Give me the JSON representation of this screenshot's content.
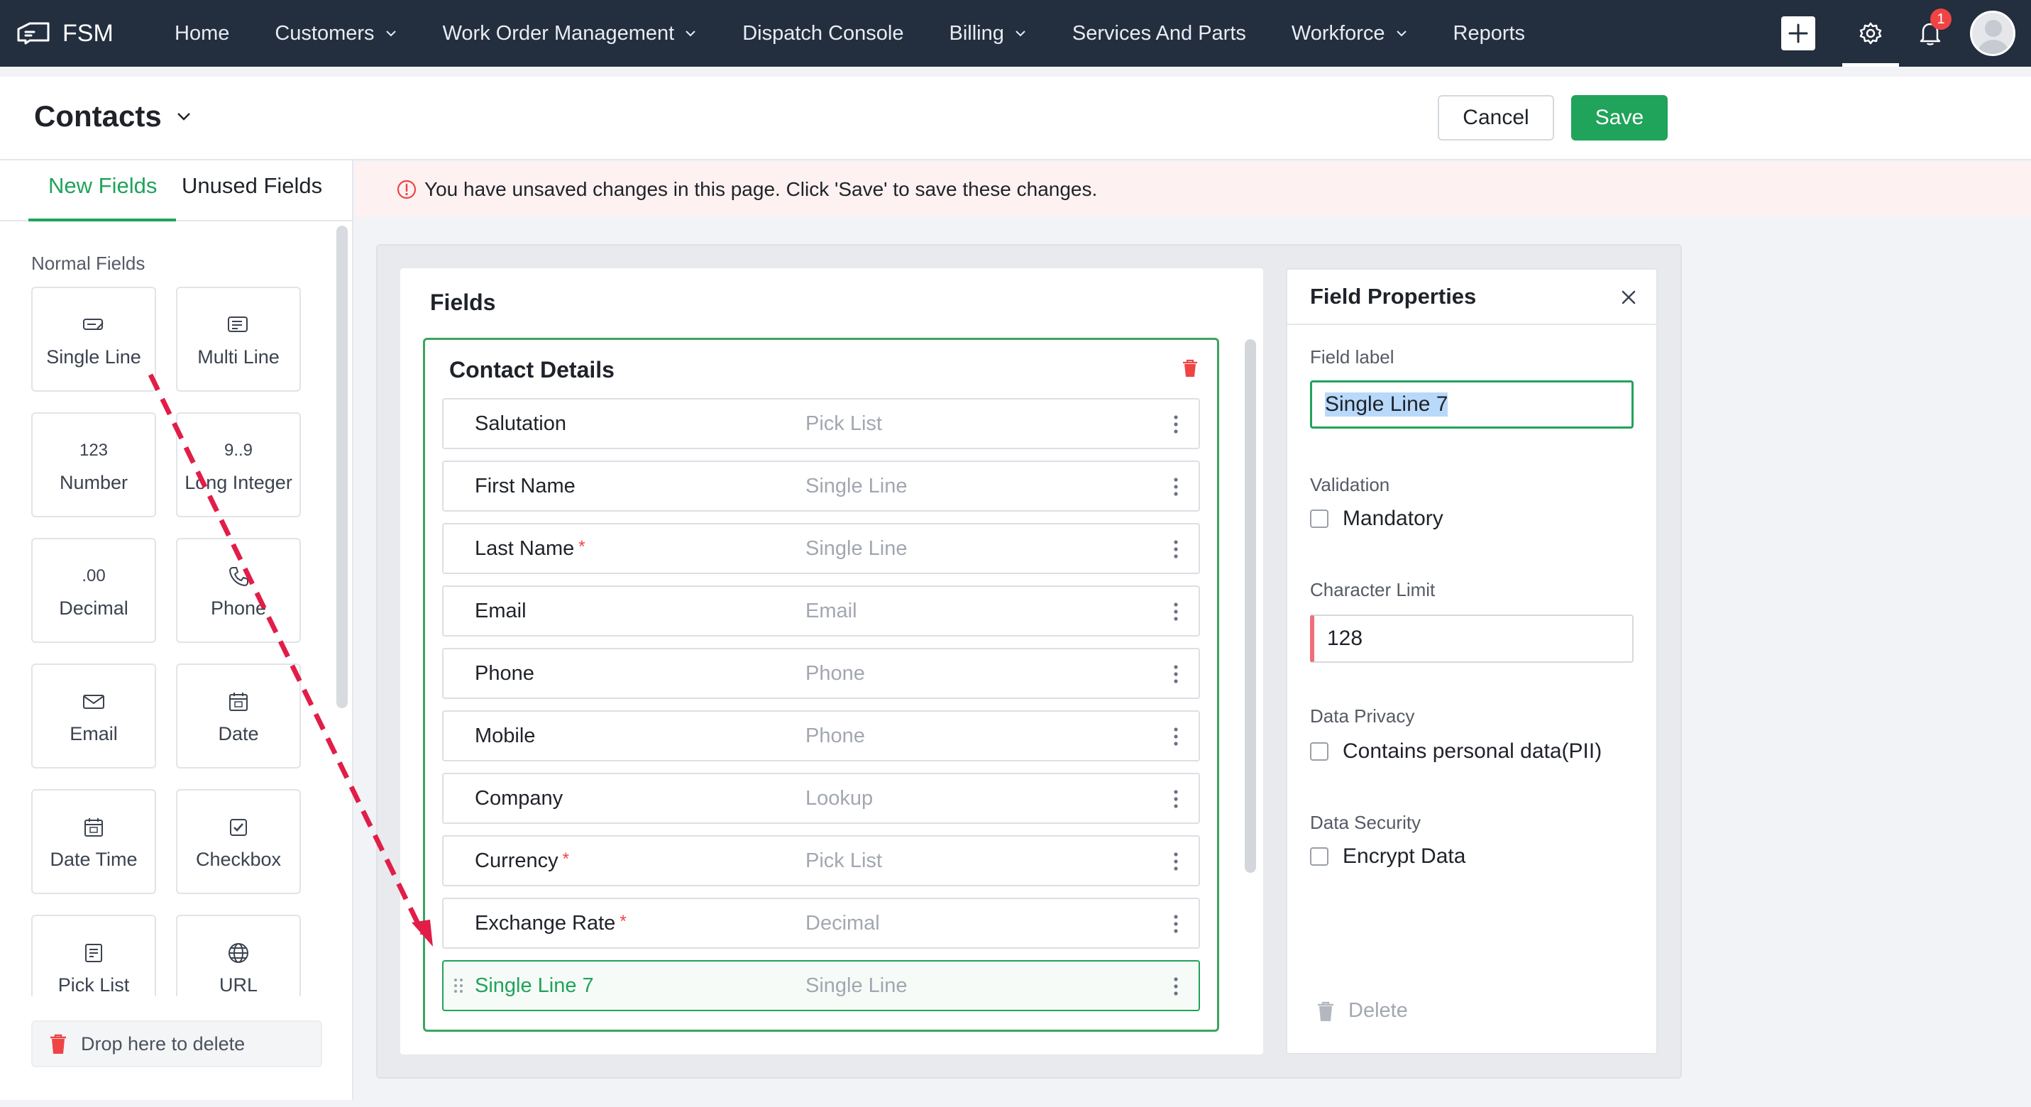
{
  "nav": {
    "brand": "FSM",
    "items": [
      {
        "label": "Home",
        "dropdown": false
      },
      {
        "label": "Customers",
        "dropdown": true
      },
      {
        "label": "Work Order Management",
        "dropdown": true
      },
      {
        "label": "Dispatch Console",
        "dropdown": false
      },
      {
        "label": "Billing",
        "dropdown": true
      },
      {
        "label": "Services And Parts",
        "dropdown": false
      },
      {
        "label": "Workforce",
        "dropdown": true
      },
      {
        "label": "Reports",
        "dropdown": false
      }
    ],
    "notification_count": "1"
  },
  "header": {
    "title": "Contacts",
    "cancel_label": "Cancel",
    "save_label": "Save"
  },
  "left_panel": {
    "tabs": [
      "New Fields",
      "Unused Fields"
    ],
    "active_tab": "New Fields",
    "section_label": "Normal Fields",
    "palette": [
      {
        "label": "Single Line",
        "icon": "single-line-icon",
        "glyph": ""
      },
      {
        "label": "Multi Line",
        "icon": "multi-line-icon",
        "glyph": ""
      },
      {
        "label": "Number",
        "icon": "number-icon",
        "glyph": "123"
      },
      {
        "label": "Long Integer",
        "icon": "long-integer-icon",
        "glyph": "9..9"
      },
      {
        "label": "Decimal",
        "icon": "decimal-icon",
        "glyph": ".00"
      },
      {
        "label": "Phone",
        "icon": "phone-icon",
        "glyph": ""
      },
      {
        "label": "Email",
        "icon": "email-icon",
        "glyph": ""
      },
      {
        "label": "Date",
        "icon": "date-icon",
        "glyph": ""
      },
      {
        "label": "Date Time",
        "icon": "date-time-icon",
        "glyph": ""
      },
      {
        "label": "Checkbox",
        "icon": "checkbox-icon",
        "glyph": ""
      },
      {
        "label": "Pick List",
        "icon": "pick-list-icon",
        "glyph": ""
      },
      {
        "label": "URL",
        "icon": "url-icon",
        "glyph": ""
      }
    ],
    "drop_delete_label": "Drop here to delete"
  },
  "banner": {
    "message": "You have unsaved changes in this page. Click 'Save' to save these changes."
  },
  "fields_panel": {
    "title": "Fields",
    "section_title": "Contact Details",
    "rows": [
      {
        "name": "Salutation",
        "type": "Pick List",
        "required": false
      },
      {
        "name": "First Name",
        "type": "Single Line",
        "required": false
      },
      {
        "name": "Last Name",
        "type": "Single Line",
        "required": true
      },
      {
        "name": "Email",
        "type": "Email",
        "required": false
      },
      {
        "name": "Phone",
        "type": "Phone",
        "required": false
      },
      {
        "name": "Mobile",
        "type": "Phone",
        "required": false
      },
      {
        "name": "Company",
        "type": "Lookup",
        "required": false
      },
      {
        "name": "Currency",
        "type": "Pick List",
        "required": true
      },
      {
        "name": "Exchange Rate",
        "type": "Decimal",
        "required": true
      },
      {
        "name": "Single Line 7",
        "type": "Single Line",
        "required": false,
        "selected": true
      }
    ]
  },
  "properties": {
    "title": "Field Properties",
    "field_label_caption": "Field label",
    "field_label_value": "Single Line 7",
    "validation_caption": "Validation",
    "mandatory_label": "Mandatory",
    "char_limit_caption": "Character Limit",
    "char_limit_value": "128",
    "privacy_caption": "Data Privacy",
    "pii_label": "Contains personal data(PII)",
    "security_caption": "Data Security",
    "encrypt_label": "Encrypt Data",
    "delete_label": "Delete"
  },
  "colors": {
    "nav_bg": "#232e3e",
    "accent_green": "#20a35a",
    "required_red": "#ef4444",
    "drag_arrow": "#e11d48"
  }
}
